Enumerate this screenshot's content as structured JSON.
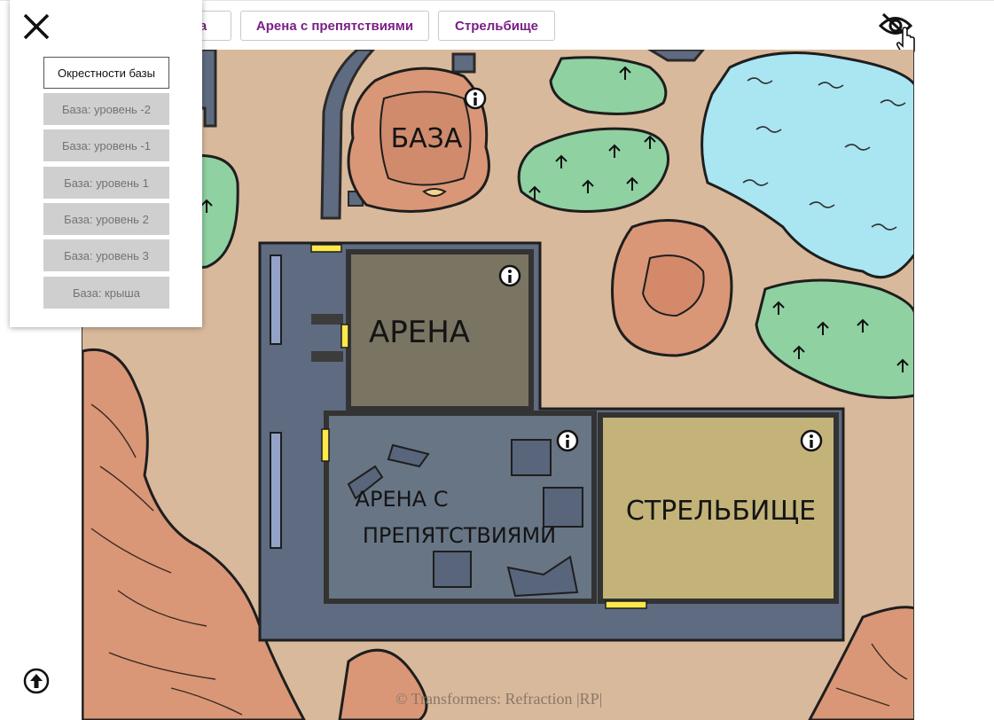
{
  "tabs": {
    "tab1": "на",
    "tab2": "Арена с препятствиями",
    "tab3": "Стрельбище"
  },
  "icons": {
    "visibility": "eye-slash-icon",
    "close": "close-icon",
    "scroll_top": "arrow-up-circle-icon",
    "info": "info-icon"
  },
  "colors": {
    "tab_text": "#7a1f86",
    "water": "#a9e6f2",
    "grass": "#8fd1a1",
    "ground": "#d9b99c",
    "rock": "#d99777"
  },
  "map": {
    "labels": {
      "base": "БАЗА",
      "arena": "АРЕНА",
      "obstacle_line1": "АРЕНА С",
      "obstacle_line2": "ПРЕПЯТСТВИЯМИ",
      "range": "СТРЕЛЬБИЩЕ"
    },
    "copyright": "© Transformers: Refraction |RP|"
  },
  "levels": {
    "items": [
      {
        "label": "Окрестности базы",
        "active": true
      },
      {
        "label": "База: уровень -2",
        "active": false
      },
      {
        "label": "База: уровень -1",
        "active": false
      },
      {
        "label": "База: уровень 1",
        "active": false
      },
      {
        "label": "База: уровень 2",
        "active": false
      },
      {
        "label": "База: уровень 3",
        "active": false
      },
      {
        "label": "База: крыша",
        "active": false
      }
    ]
  }
}
